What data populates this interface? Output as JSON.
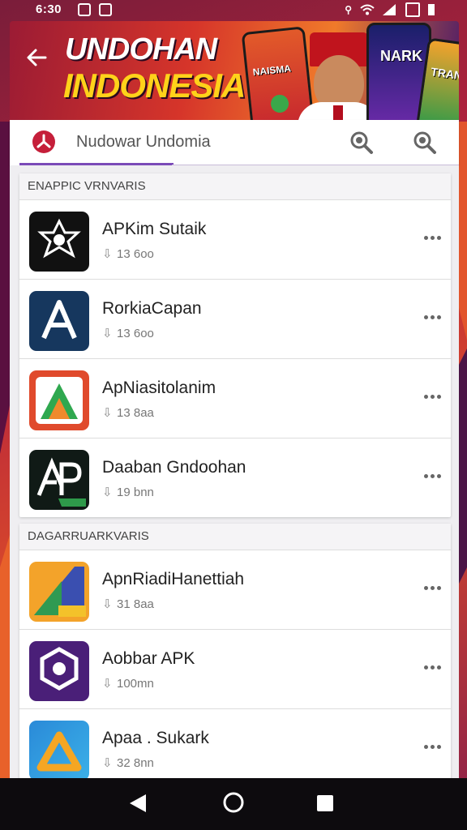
{
  "status_bar": {
    "time": "6:30"
  },
  "banner": {
    "title_line1": "UNDOHAN",
    "title_line2": "INDONESIA",
    "phone1_text": "NAISMA",
    "phone2_text": "NARK",
    "phone3_text": "TRAN"
  },
  "search": {
    "app_name": "Nudowar Undomia"
  },
  "colors": {
    "accent": "#7b4ab8",
    "brand": "#c51f3a"
  },
  "sections": [
    {
      "header": "ENAPPIC VRNVARIS",
      "apps": [
        {
          "name": "APKim Sutaik",
          "size": "13 6oo",
          "icon": "star-badge-icon"
        },
        {
          "name": "RorkiaCapan",
          "size": "13 6oo",
          "icon": "letter-a-icon"
        },
        {
          "name": "ApNiasitolanim",
          "size": "13 8aa",
          "icon": "play-triangle-icon"
        },
        {
          "name": "Daaban Gndoohan",
          "size": "19 bnn",
          "icon": "apk-logo-icon"
        }
      ]
    },
    {
      "header": "DAGARRUARKVARIS",
      "apps": [
        {
          "name": "ApnRiadiHanettiah",
          "size": "31 8aa",
          "icon": "apk-triangle-icon"
        },
        {
          "name": "Aobbar APK",
          "size": "100mn",
          "icon": "puzzle-badge-icon"
        },
        {
          "name": "Apaa . Sukark",
          "size": "32 8nn",
          "icon": "gradient-triangle-icon"
        }
      ]
    }
  ]
}
